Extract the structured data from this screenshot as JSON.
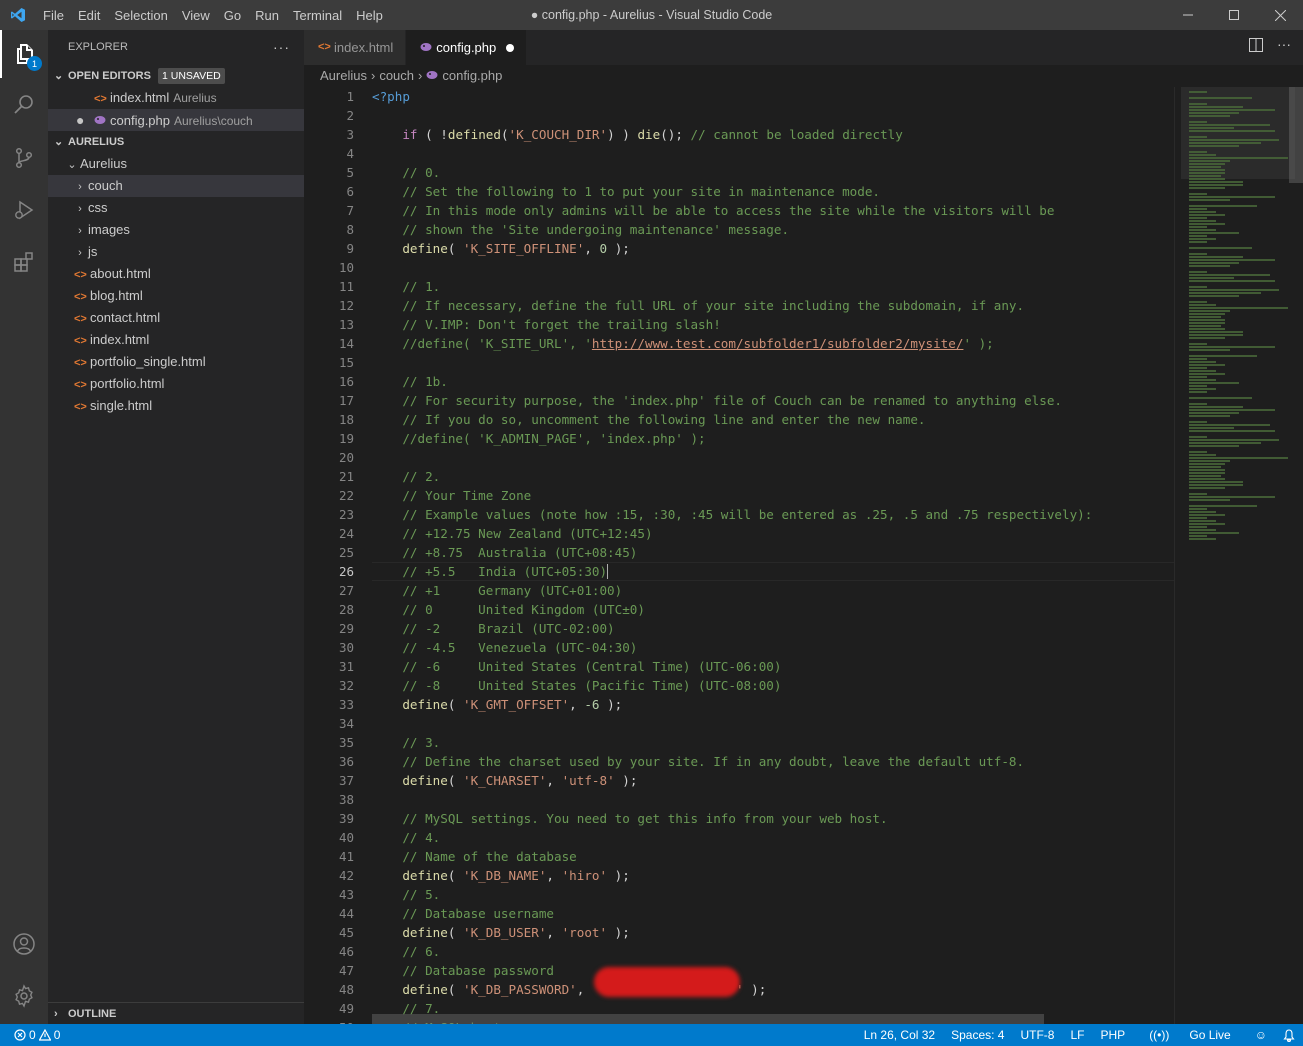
{
  "menu": [
    "File",
    "Edit",
    "Selection",
    "View",
    "Go",
    "Run",
    "Terminal",
    "Help"
  ],
  "window_title": "● config.php - Aurelius - Visual Studio Code",
  "explorer": {
    "title": "EXPLORER",
    "open_editors": "OPEN EDITORS",
    "unsaved": "1 UNSAVED",
    "open_files": [
      {
        "name": "index.html",
        "desc": "Aurelius"
      },
      {
        "name": "config.php",
        "desc": "Aurelius\\couch"
      }
    ],
    "workspace": "AURELIUS",
    "root": "Aurelius",
    "folders": [
      "couch",
      "css",
      "images",
      "js"
    ],
    "files": [
      "about.html",
      "blog.html",
      "contact.html",
      "index.html",
      "portfolio_single.html",
      "portfolio.html",
      "single.html"
    ],
    "outline": "OUTLINE"
  },
  "activity_badge": "1",
  "tabs": [
    {
      "label": "index.html",
      "active": false
    },
    {
      "label": "config.php",
      "active": true,
      "modified": true
    }
  ],
  "breadcrumb": [
    "Aurelius",
    "couch",
    "config.php"
  ],
  "editor": {
    "current_line": 26,
    "line_count": 50
  },
  "status": {
    "errors": "0",
    "warnings": "0",
    "position": "Ln 26, Col 32",
    "spaces": "Spaces: 4",
    "encoding": "UTF-8",
    "eol": "LF",
    "language": "PHP",
    "golive": "Go Live"
  }
}
